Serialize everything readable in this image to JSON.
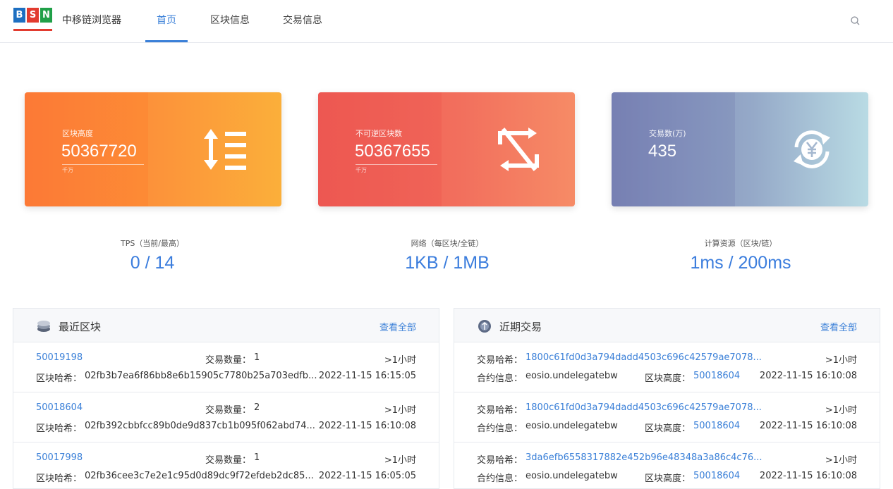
{
  "header": {
    "logo_letters": [
      "B",
      "S",
      "N"
    ],
    "brand": "中移链浏览器",
    "nav": [
      {
        "label": "首页",
        "active": true
      },
      {
        "label": "区块信息",
        "active": false
      },
      {
        "label": "交易信息",
        "active": false
      }
    ]
  },
  "cards": [
    {
      "label": "区块高度",
      "value": "50367720",
      "unit": "千万",
      "icon": "sort-arrows-icon"
    },
    {
      "label": "不可逆区块数",
      "value": "50367655",
      "unit": "千万",
      "icon": "no-repeat-icon"
    },
    {
      "label": "交易数(万)",
      "value": "435",
      "icon": "yuan-exchange-icon"
    }
  ],
  "metrics": [
    {
      "label": "TPS（当前/最高）",
      "value": "0 / 14"
    },
    {
      "label": "网络（每区块/全链）",
      "value": "1KB / 1MB"
    },
    {
      "label": "计算资源（区块/链）",
      "value": "1ms / 200ms"
    }
  ],
  "recent_blocks": {
    "title": "最近区块",
    "view_all": "查看全部",
    "rows": [
      {
        "height": "50019198",
        "tx_label": "交易数量：",
        "tx_count": "1",
        "age": ">1小时",
        "hash_label": "区块哈希：",
        "hash": "02fb3b7ea6f86bb8e6b15905c7780b25a703edfb...",
        "time": "2022-11-15 16:15:05"
      },
      {
        "height": "50018604",
        "tx_label": "交易数量：",
        "tx_count": "2",
        "age": ">1小时",
        "hash_label": "区块哈希：",
        "hash": "02fb392cbbfcc89b0de9d837cb1b095f062abd74...",
        "time": "2022-11-15 16:10:08"
      },
      {
        "height": "50017998",
        "tx_label": "交易数量：",
        "tx_count": "1",
        "age": ">1小时",
        "hash_label": "区块哈希：",
        "hash": "02fb36cee3c7e2e1c95d0d89dc9f72efdeb2dc85...",
        "time": "2022-11-15 16:05:05"
      }
    ]
  },
  "recent_transactions": {
    "title": "近期交易",
    "view_all": "查看全部",
    "rows": [
      {
        "hash_label": "交易哈希：",
        "hash": "1800c61fd0d3a794dadd4503c696c42579ae7078...",
        "age": ">1小时",
        "contract_label": "合约信息：",
        "contract": "eosio.undelegatebw",
        "height_label": "区块高度：",
        "height": "50018604",
        "time": "2022-11-15 16:10:08"
      },
      {
        "hash_label": "交易哈希：",
        "hash": "1800c61fd0d3a794dadd4503c696c42579ae7078...",
        "age": ">1小时",
        "contract_label": "合约信息：",
        "contract": "eosio.undelegatebw",
        "height_label": "区块高度：",
        "height": "50018604",
        "time": "2022-11-15 16:10:08"
      },
      {
        "hash_label": "交易哈希：",
        "hash": "3da6efb6558317882e452b96e48348a3a86c4c76...",
        "age": ">1小时",
        "contract_label": "合约信息：",
        "contract": "eosio.undelegatebw",
        "height_label": "区块高度：",
        "height": "50018604",
        "time": "2022-11-15 16:10:08"
      }
    ]
  }
}
